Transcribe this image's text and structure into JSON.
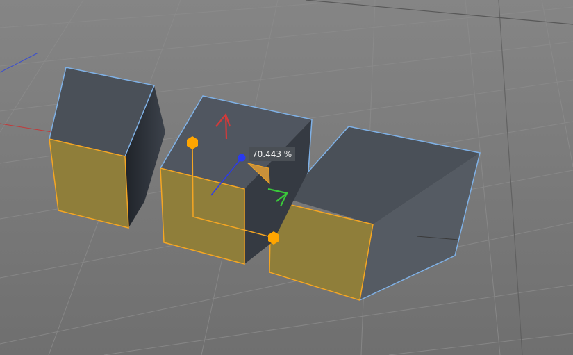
{
  "viewport": {
    "scale_readout": "70.443 %"
  },
  "colors": {
    "background": "#7a7a7a",
    "grid_line": "#8a8a8a",
    "grid_major": "#5c5c5c",
    "face_dark": "#3c424b",
    "face_mid": "#4a5058",
    "face_light": "#545a62",
    "selected_face": "#8f7e3a",
    "selection_edge": "#f5a623",
    "object_edge": "#7fb1e6",
    "gizmo_x": "#d33a3a",
    "gizmo_y": "#3ac93a",
    "gizmo_z": "#2a3af0",
    "handle": "#ffa500"
  }
}
